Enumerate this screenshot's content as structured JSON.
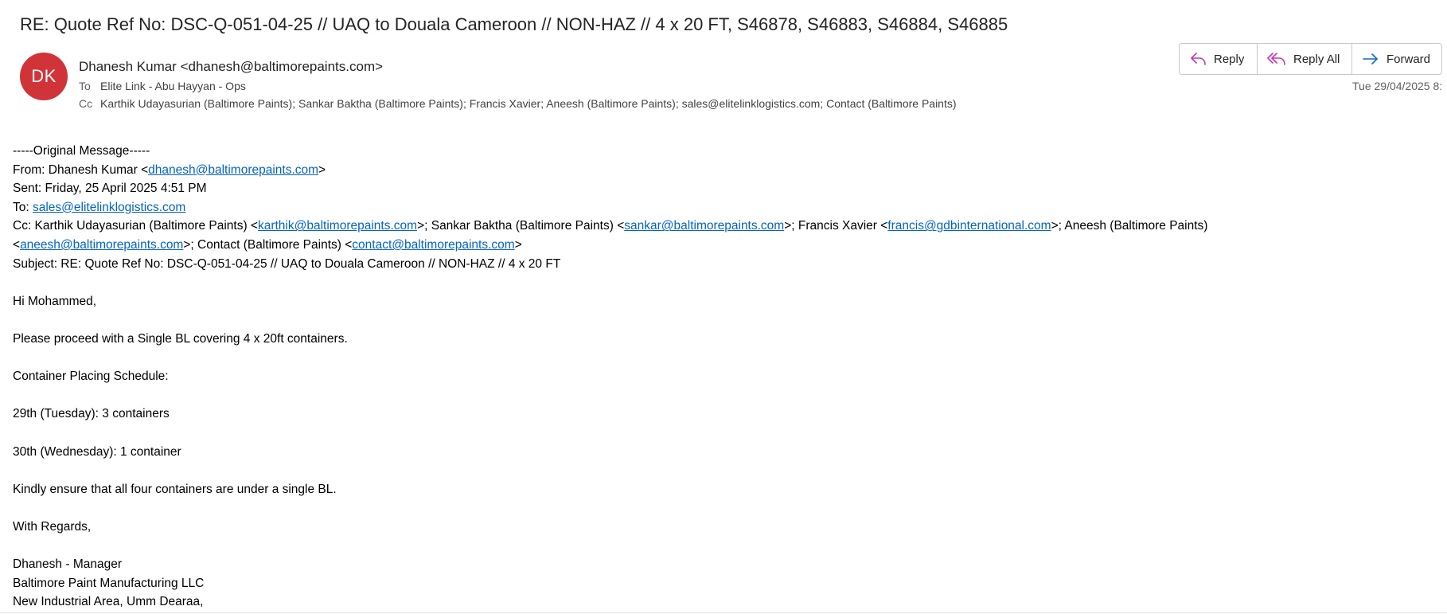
{
  "email": {
    "subject": "RE: Quote Ref No: DSC-Q-051-04-25 // UAQ to Douala Cameroon // NON-HAZ // 4 x 20 FT, S46878, S46883, S46884, S46885",
    "avatar_initials": "DK",
    "avatar_color": "#d13438",
    "sender": "Dhanesh Kumar <dhanesh@baltimorepaints.com>",
    "to_label": "To",
    "to_value": "Elite Link - Abu Hayyan - Ops",
    "cc_label": "Cc",
    "cc_value": "Karthik Udayasurian (Baltimore Paints); Sankar Baktha (Baltimore Paints); Francis Xavier; Aneesh (Baltimore Paints); sales@elitelinklogistics.com; Contact (Baltimore Paints)",
    "timestamp": "Tue 29/04/2025 8:"
  },
  "actions": {
    "reply": "Reply",
    "reply_all": "Reply All",
    "forward": "Forward",
    "reply_icon_color": "#c239b3",
    "forward_icon_color": "#0f6cbd"
  },
  "body": {
    "original_header": "-----Original Message-----",
    "from_prefix": "From: Dhanesh Kumar <",
    "from_email": "dhanesh@baltimorepaints.com",
    "from_suffix": ">",
    "sent": "Sent: Friday, 25 April 2025 4:51 PM",
    "to_prefix": "To: ",
    "to_email": "sales@elitelinklogistics.com",
    "cc_prefix": "Cc: Karthik Udayasurian (Baltimore Paints) <",
    "cc_email1": "karthik@baltimorepaints.com",
    "cc_mid1": ">; Sankar Baktha (Baltimore Paints) <",
    "cc_email2": "sankar@baltimorepaints.com",
    "cc_mid2": ">; Francis Xavier <",
    "cc_email3": "francis@gdbinternational.com",
    "cc_mid3": ">; Aneesh (Baltimore Paints)",
    "cc2_prefix": "<",
    "cc_email4": "aneesh@baltimorepaints.com",
    "cc_mid4": ">; Contact (Baltimore Paints) <",
    "cc_email5": "contact@baltimorepaints.com",
    "cc_suffix": ">",
    "subject_line": "Subject: RE: Quote Ref No: DSC-Q-051-04-25 // UAQ to Douala Cameroon // NON-HAZ // 4 x 20 FT",
    "greeting": "Hi Mohammed,",
    "para1": "Please proceed with a Single BL covering 4 x 20ft containers.",
    "schedule_heading": "Container Placing Schedule:",
    "schedule1": "29th (Tuesday): 3 containers",
    "schedule2": "30th (Wednesday): 1 container",
    "para2": "Kindly ensure that all four containers are under a single BL.",
    "closing": "With Regards,",
    "sig_name": "Dhanesh - Manager",
    "sig_company": "Baltimore Paint Manufacturing LLC",
    "sig_address": "New Industrial Area, Umm Dearaa,"
  }
}
